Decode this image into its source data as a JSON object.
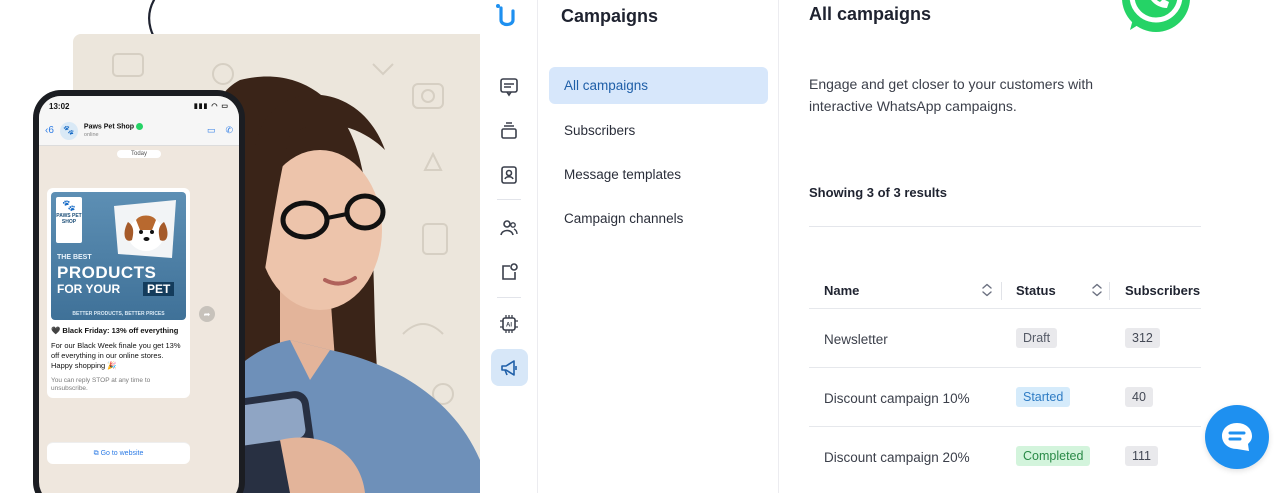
{
  "hero": {
    "phone": {
      "time": "13:02",
      "back_count": "6",
      "contact_name": "Paws Pet Shop",
      "contact_status": "online",
      "date_chip": "Today",
      "promo": {
        "logo_text": "PAWS PET SHOP",
        "line1": "THE BEST",
        "line2": "PRODUCTS",
        "line3": "FOR YOUR",
        "line3_highlight": "PET",
        "footer": "BETTER PRODUCTS, BETTER PRICES"
      },
      "message_heading": "🖤 Black Friday: 13% off everything",
      "message_body": "For our Black Week finale you get 13% off everything in our online stores. Happy shopping 🎉",
      "message_footer": "You can reply STOP at any time to unsubscribe.",
      "link_label": "Go to website"
    }
  },
  "rail": {
    "icons": [
      "brand-logo-icon",
      "chat-icon",
      "inbox-stack-icon",
      "contact-card-icon",
      "users-icon",
      "notification-square-icon",
      "ai-chip-icon",
      "megaphone-icon"
    ],
    "active": "megaphone-icon"
  },
  "subnav": {
    "title": "Campaigns",
    "items": [
      {
        "label": "All campaigns",
        "active": true
      },
      {
        "label": "Subscribers",
        "active": false
      },
      {
        "label": "Message templates",
        "active": false
      },
      {
        "label": "Campaign channels",
        "active": false
      }
    ]
  },
  "main": {
    "title": "All campaigns",
    "intro": "Engage and get closer to your customers with interactive WhatsApp campaigns.",
    "results": "Showing 3 of 3 results",
    "columns": [
      "Name",
      "Status",
      "Subscribers"
    ],
    "rows": [
      {
        "name": "Newsletter",
        "status": "Draft",
        "status_kind": "draft",
        "subscribers": "312"
      },
      {
        "name": "Discount campaign 10%",
        "status": "Started",
        "status_kind": "started",
        "subscribers": "40"
      },
      {
        "name": "Discount campaign 20%",
        "status": "Completed",
        "status_kind": "completed",
        "subscribers": "111"
      }
    ]
  },
  "colors": {
    "accent": "#1e90f0",
    "nav_active_bg": "#d7e7fb",
    "whatsapp_green": "#25d366"
  }
}
